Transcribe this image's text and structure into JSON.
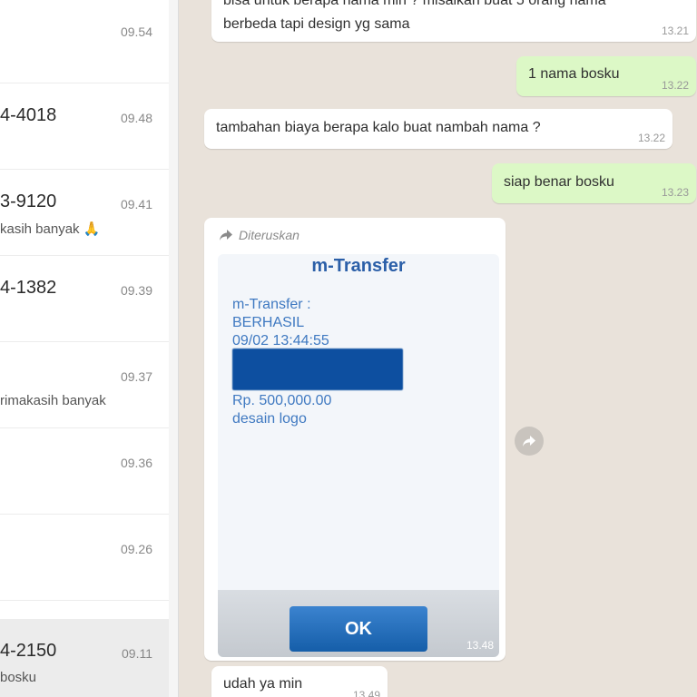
{
  "chat_list": {
    "items": [
      {
        "name": "",
        "time": "09.54",
        "preview": ""
      },
      {
        "name": "4-4018",
        "time": "09.48",
        "preview": ""
      },
      {
        "name": "3-9120",
        "time": "09.41",
        "preview": "kasih  banyak 🙏"
      },
      {
        "name": "4-1382",
        "time": "09.39",
        "preview": ""
      },
      {
        "name": "",
        "time": "09.37",
        "preview": "rimakasih banyak"
      },
      {
        "name": "",
        "time": "09.36",
        "preview": ""
      },
      {
        "name": "",
        "time": "09.26",
        "preview": ""
      },
      {
        "name": "4-2150",
        "time": "09.11",
        "preview": "bosku"
      }
    ]
  },
  "messages": [
    {
      "direction": "in",
      "lines": [
        "bisa untuk berapa nama min ? misalkan buat 5 orang nama",
        "berbeda tapi design yg sama"
      ],
      "time": "13.21"
    },
    {
      "direction": "out",
      "text": "1 nama bosku",
      "time": "13.22"
    },
    {
      "direction": "in",
      "text": "tambahan biaya berapa kalo buat nambah nama ?",
      "time": "13.22"
    },
    {
      "direction": "out",
      "text": "siap benar bosku",
      "time": "13.23"
    },
    {
      "direction": "in",
      "forwarded_label": "Diteruskan",
      "image": {
        "title": "m-Transfer",
        "lines": [
          "m-Transfer :",
          "BERHASIL",
          "09/02 13:44:55"
        ],
        "lines_after": [
          "Rp. 500,000.00",
          "desain logo"
        ],
        "button": "OK"
      },
      "time": "13.48"
    },
    {
      "direction": "in",
      "text": "udah ya min",
      "time": "13.49"
    }
  ],
  "icons": {
    "forward": "forward-arrow-icon"
  },
  "colors": {
    "outgoing_bubble": "#dcf8c6",
    "incoming_bubble": "#ffffff",
    "chat_background": "#e9e2da",
    "transfer_blue": "#2b5fa8"
  }
}
